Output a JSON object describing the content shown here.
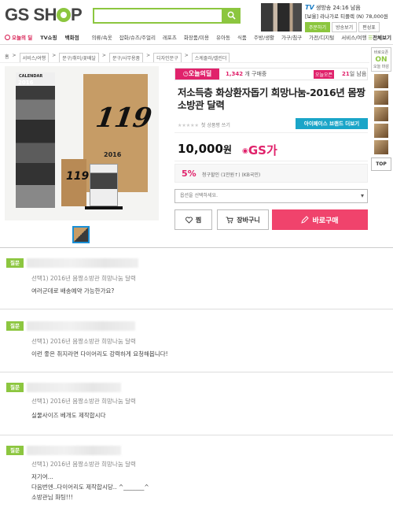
{
  "header": {
    "logo_text_1": "GS SH",
    "logo_text_2": "P",
    "tv": {
      "badge": "TV",
      "live_label": "생방송",
      "time": "24:16 남음",
      "product": "[보울] 라나가로 티플렉 (N) 78,000원",
      "buttons": [
        "주문하기",
        "방송보기",
        "편성표"
      ]
    }
  },
  "nav": {
    "today": "오늘의 딜",
    "main": [
      "TV쇼핑",
      "백화점"
    ],
    "categories": [
      "의류/속옷",
      "잡화/슈즈/주얼리",
      "레포츠",
      "화장품/미용",
      "유아동",
      "식품",
      "주방/생활",
      "가구/침구",
      "가전/디지털",
      "서비스/여행"
    ],
    "all": "전체보기"
  },
  "breadcrumb": [
    "홈",
    "서비스/여행",
    "문구/취미/꽃배달",
    "문구/사무용품",
    "디자인문구",
    "스케줄러/캘린더"
  ],
  "rail": {
    "label": "바로오픈",
    "on": "ON",
    "sub": "오늘 마감",
    "top": "TOP"
  },
  "product": {
    "calendar_title": "2016",
    "calendar_small_title": "CALENDAR",
    "calendar_number": "119",
    "deal_badge": "오늘의딜",
    "buyers_count": "1,342",
    "buyers_suffix": "개 구매중",
    "open_tag": "오늘오픈",
    "days_num": "21",
    "days_suffix": "일 남음",
    "title": "저소득층 화상환자돕기 희망나눔-2016년 몸짱소방관 달력",
    "rating_text": "첫 상품평 쓰기",
    "brand_button": "아이페이스 브랜드 더보기",
    "price": "10,000",
    "price_unit": "원",
    "gs_ga": "GS가",
    "discount_pct": "5%",
    "discount_text": "청구할인 (1만원↑) (KB국민)",
    "option_placeholder": "옵션을 선택하세요.",
    "btn_jjim": "찜",
    "btn_cart": "장바구니",
    "btn_buy": "바로구매"
  },
  "qa": [
    {
      "tag": "질문",
      "option": "선택1) 2016년 몸짱소방관 희망나눔 달력",
      "body": [
        "여러군데로 배송예약 가능한가요?"
      ]
    },
    {
      "tag": "질문",
      "option": "선택1) 2016년 몸짱소방관 희망나눔 달력",
      "body": [
        "이런 좋은 취지라면 다이어리도 강력하게 요청해봅니다!"
      ]
    },
    {
      "tag": "질문",
      "option": "선택1) 2016년 몸짱소방관 희망나눔 달력",
      "body": [
        "실물사이즈 베개도 제작합시다"
      ]
    },
    {
      "tag": "질문",
      "option": "선택1) 2016년 몸짱소방관 희망나눔 달력",
      "body": [
        "저기여...",
        "다음번엔..다이어리도 제작합시당.. ^_______^",
        "소방관님 화팅!!!"
      ]
    }
  ]
}
